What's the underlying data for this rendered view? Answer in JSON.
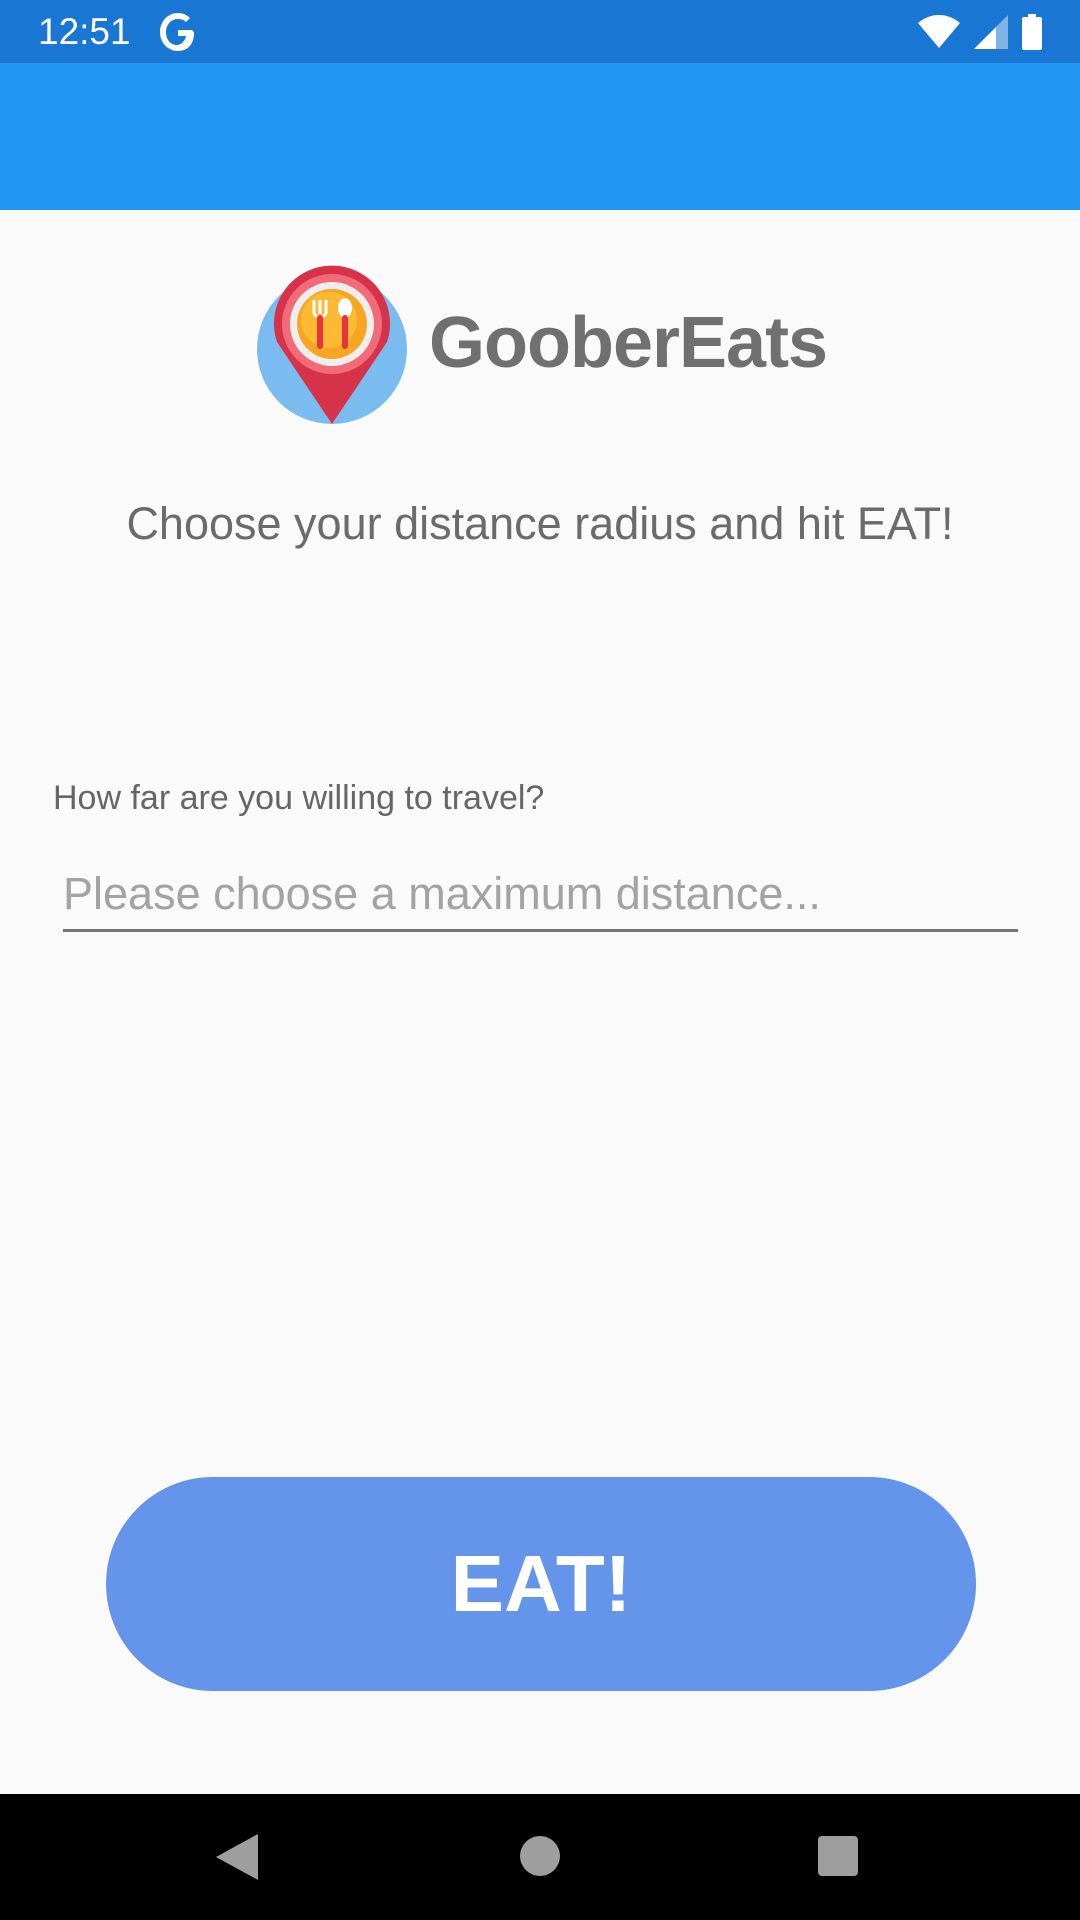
{
  "status_bar": {
    "time": "12:51",
    "icons": [
      "google-g-icon",
      "wifi-icon",
      "cellular-signal-icon",
      "battery-icon"
    ]
  },
  "app": {
    "name": "GooberEats",
    "logo_icon": "restaurant-location-pin-icon"
  },
  "main": {
    "tagline": "Choose your distance radius and hit EAT!",
    "distance_label": "How far are you willing to travel?",
    "distance_select": {
      "value": "",
      "placeholder": "Please choose a maximum distance..."
    },
    "eat_button_label": "EAT!"
  },
  "nav_bar": {
    "icons": [
      "back-icon",
      "home-icon",
      "recents-icon"
    ]
  },
  "colors": {
    "status_bar": "#1976d2",
    "app_bar": "#2196f3",
    "background": "#fafafa",
    "eat_button": "#6495ea",
    "brand_text": "#707070"
  }
}
